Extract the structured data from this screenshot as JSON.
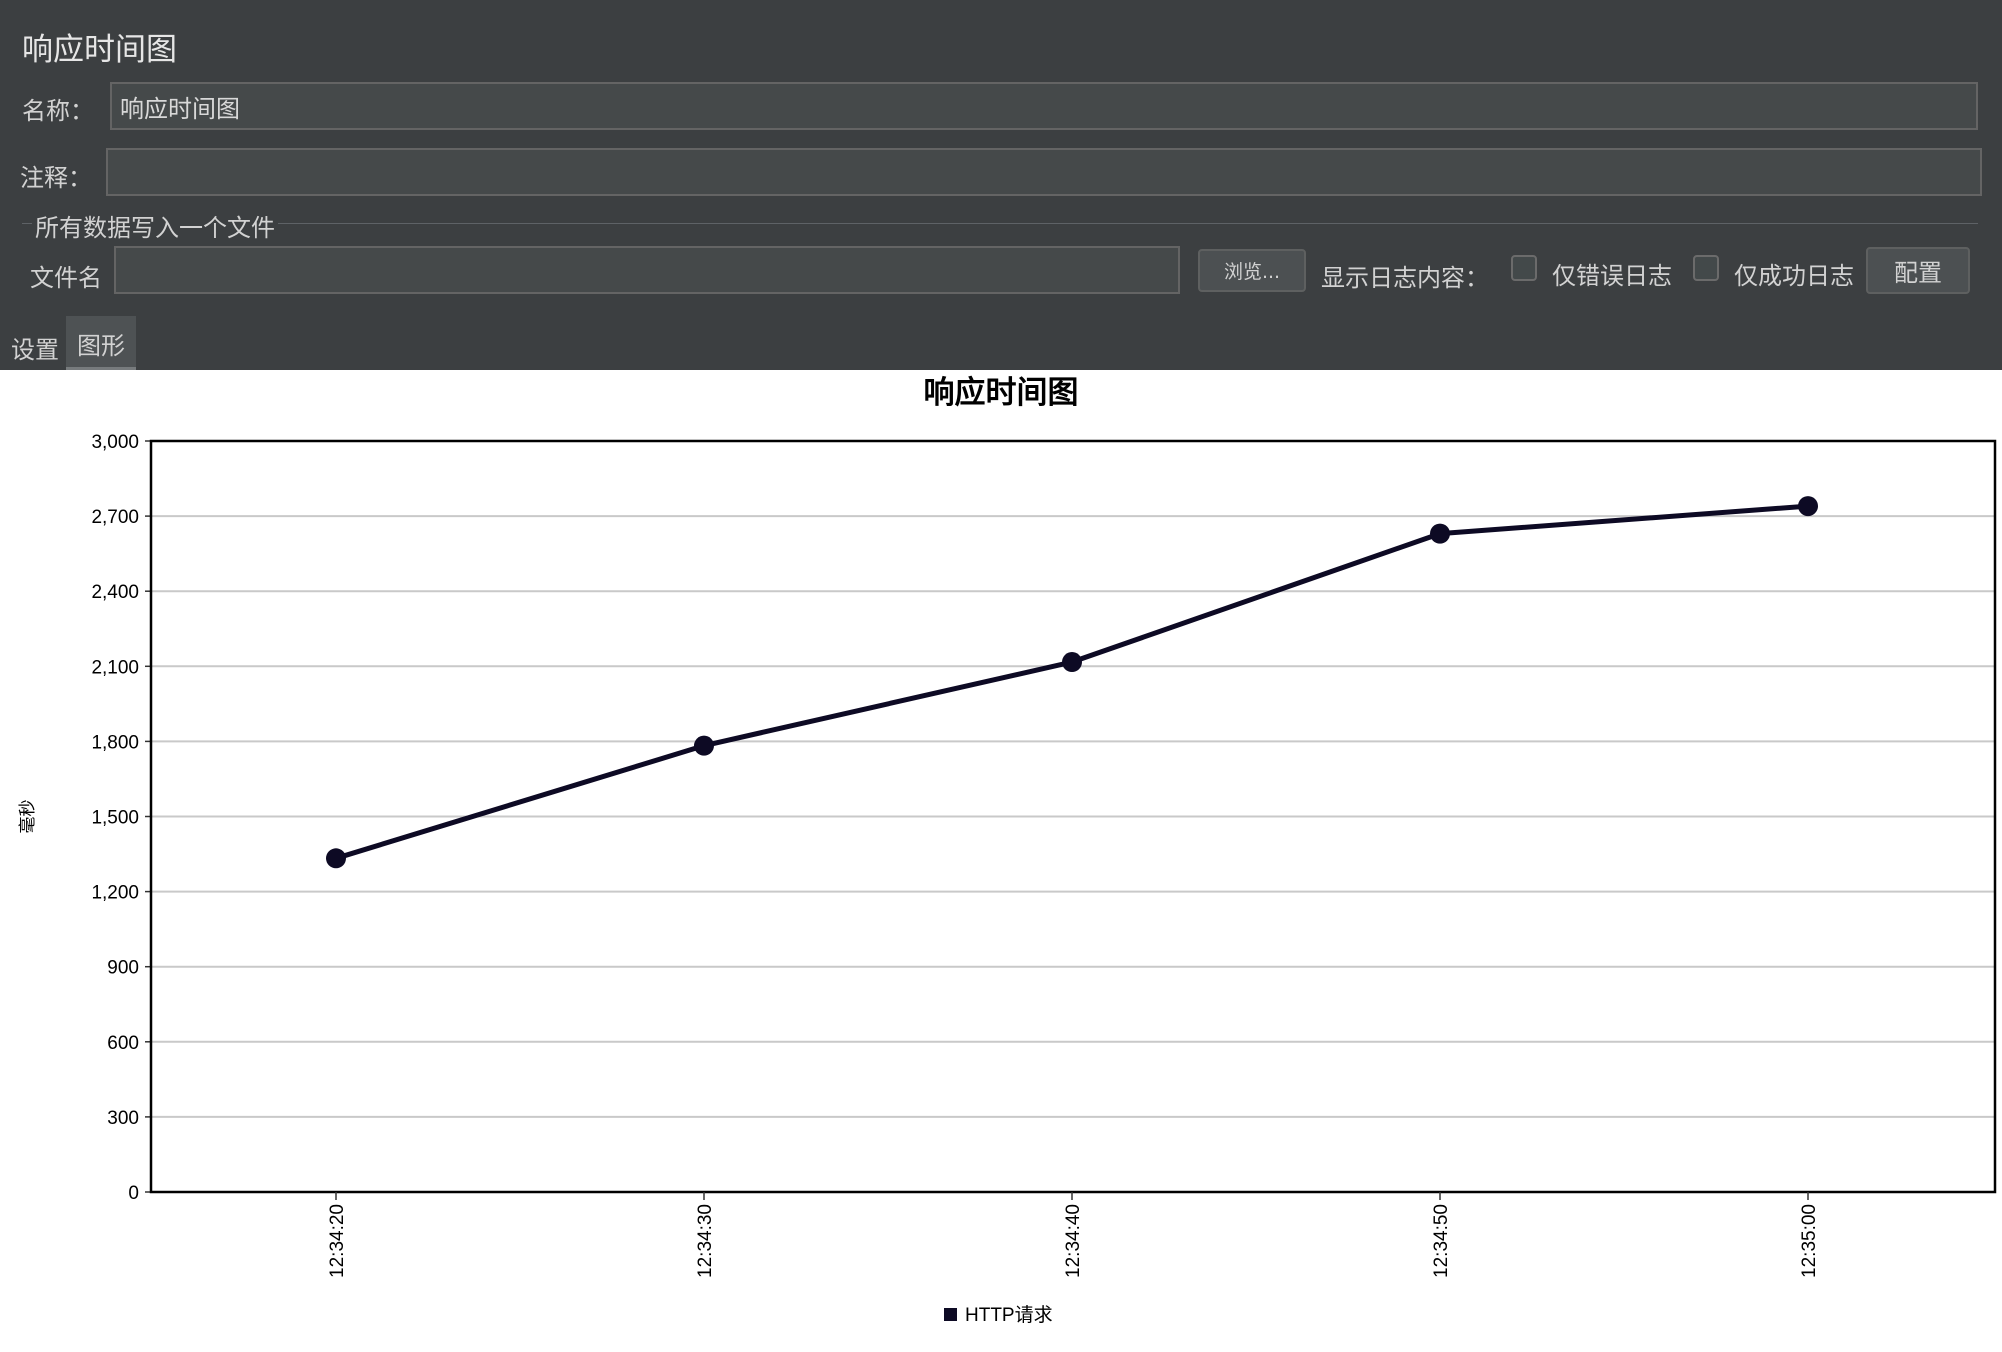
{
  "panel": {
    "title": "响应时间图",
    "name_label": "名称：",
    "name_value": "响应时间图",
    "comment_label": "注释：",
    "comment_value": "",
    "file_group_title": "所有数据写入一个文件",
    "filename_label": "文件名",
    "filename_value": "",
    "browse_label": "浏览...",
    "log_content_label": "显示日志内容：",
    "errors_only_label": "仅错误日志",
    "errors_only_checked": false,
    "success_only_label": "仅成功日志",
    "success_only_checked": false,
    "configure_label": "配置",
    "tabs": [
      {
        "label": "设置",
        "active": false
      },
      {
        "label": "图形",
        "active": true
      }
    ]
  },
  "chart_data": {
    "type": "line",
    "title": "响应时间图",
    "xlabel": "",
    "ylabel": "毫秒",
    "categories": [
      "12:34:20",
      "12:34:30",
      "12:34:40",
      "12:34:50",
      "12:35:00"
    ],
    "series": [
      {
        "name": "HTTP请求",
        "values": [
          1333,
          1783,
          2117,
          2630,
          2740
        ],
        "color": "#0d0a24"
      }
    ],
    "ylim": [
      0,
      3000
    ],
    "yticks": [
      0,
      300,
      600,
      900,
      1200,
      1500,
      1800,
      2100,
      2400,
      2700,
      3000
    ],
    "ytick_labels": [
      "0",
      "300",
      "600",
      "900",
      "1,200",
      "1,500",
      "1,800",
      "2,100",
      "2,400",
      "2,700",
      "3,000"
    ],
    "grid": true,
    "legend": "bottom"
  }
}
